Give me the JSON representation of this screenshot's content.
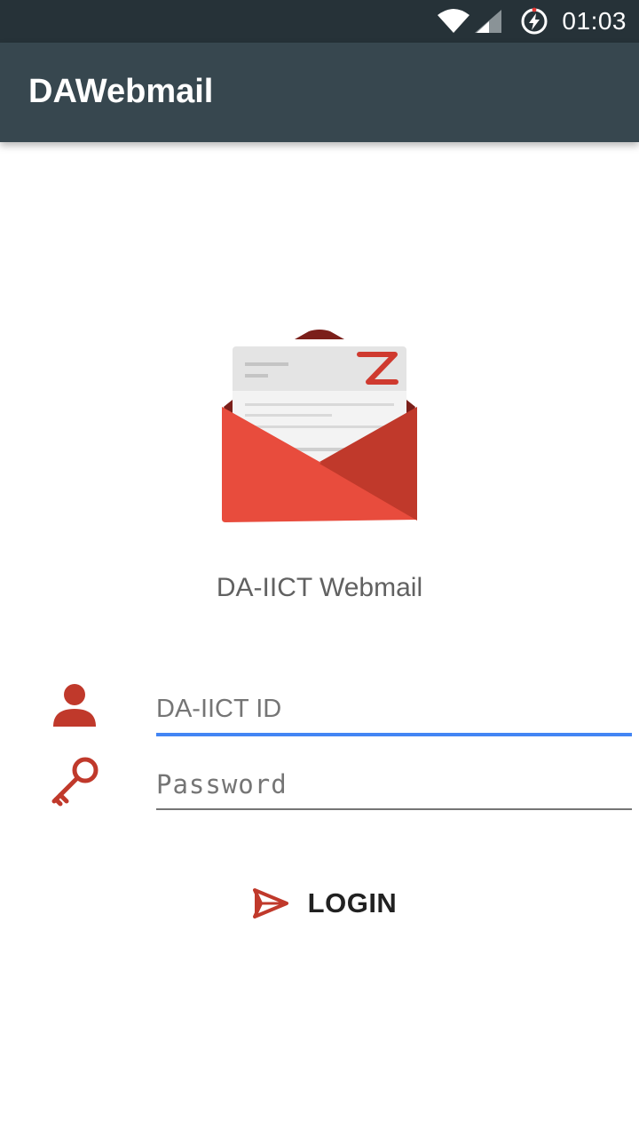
{
  "status_bar": {
    "time": "01:03",
    "icons": [
      "wifi-icon",
      "cell-signal-icon",
      "battery-charging-icon"
    ]
  },
  "app_bar": {
    "title": "DAWebmail"
  },
  "logo": {
    "icon": "envelope-logo-icon",
    "app_name": "DA-IICT Webmail"
  },
  "form": {
    "id_field": {
      "icon": "person-icon",
      "placeholder": "DA-IICT ID",
      "value": ""
    },
    "password_field": {
      "icon": "key-icon",
      "placeholder": "Password",
      "value": ""
    },
    "login_button": {
      "icon": "send-icon",
      "label": "LOGIN"
    }
  },
  "colors": {
    "status_bar": "#263238",
    "app_bar": "#37474f",
    "accent_red": "#c0392b",
    "focus_blue": "#4285f4"
  }
}
